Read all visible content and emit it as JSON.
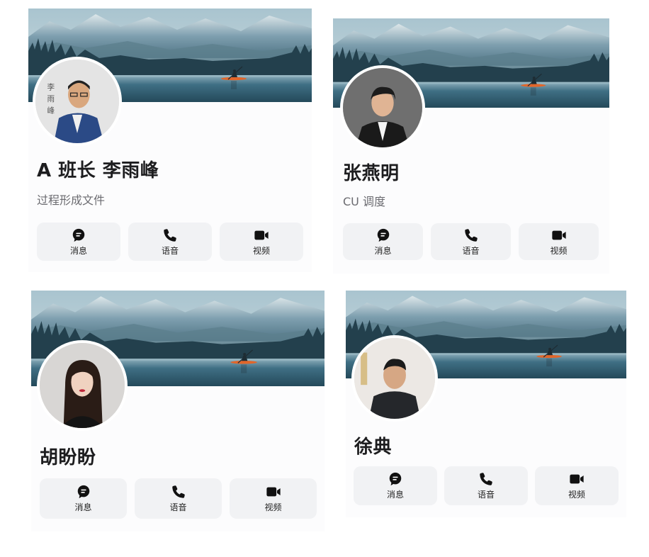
{
  "contacts": [
    {
      "name": "A 班长 李雨峰",
      "subtitle": "过程形成文件",
      "avatar": "person-blue-suit-avatar",
      "actions": {
        "message": "消息",
        "voice": "语音",
        "video": "视频"
      }
    },
    {
      "name": "张燕明",
      "subtitle": "CU 调度",
      "avatar": "person-black-suit-avatar",
      "actions": {
        "message": "消息",
        "voice": "语音",
        "video": "视频"
      }
    },
    {
      "name": "胡盼盼",
      "subtitle": "",
      "avatar": "person-long-hair-avatar",
      "actions": {
        "message": "消息",
        "voice": "语音",
        "video": "视频"
      }
    },
    {
      "name": "徐典",
      "subtitle": "",
      "avatar": "person-dark-jacket-avatar",
      "actions": {
        "message": "消息",
        "voice": "语音",
        "video": "视频"
      }
    }
  ],
  "icons": {
    "message": "chat-bubble-icon",
    "voice": "phone-icon",
    "video": "video-camera-icon"
  },
  "colors": {
    "action_bg": "#f1f2f4",
    "name_text": "#1d1d1f",
    "subtitle_text": "#6b6b70",
    "lake": "#2f5e74"
  }
}
